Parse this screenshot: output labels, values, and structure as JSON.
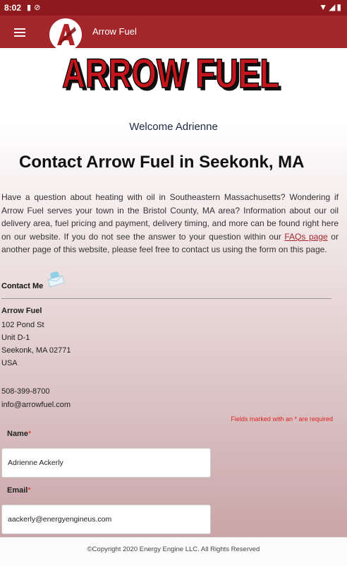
{
  "status_bar": {
    "time": "8:02",
    "left_icons": [
      "sim-card-icon",
      "sync-icon"
    ],
    "right_icons": [
      "wifi-icon",
      "signal-icon",
      "battery-icon"
    ]
  },
  "app_bar": {
    "title": "Arrow Fuel",
    "logo_letter": "A",
    "color": "#a3262a"
  },
  "banner": {
    "text": "ARROW FUEL"
  },
  "welcome": "Welcome Adrienne",
  "page_title": "Contact Arrow Fuel in Seekonk, MA",
  "intro": {
    "text_before_link": " Have a question about heating with oil in Southeastern Massachusetts? Wondering if Arrow Fuel serves your town in the Bristol County, MA area? Information about our oil delivery area, fuel pricing and payment, delivery timing, and more can be found right here on our website. If you do not see the answer to your question within our ",
    "link_text": "FAQs page",
    "text_after_link": " or another page of this website, please feel free to contact us using the form on this page."
  },
  "contact": {
    "heading": "Contact Me",
    "name": "Arrow Fuel",
    "street": "102 Pond St",
    "unit": "Unit D-1",
    "city": "Seekonk, MA 02771",
    "country": "USA",
    "phone": "508-399-8700",
    "email": "info@arrowfuel.com"
  },
  "form": {
    "required_note": "Fields marked with an * are required",
    "name_label": "Name",
    "name_value": "Adrienne Ackerly",
    "email_label": "Email",
    "email_value": "aackerly@energyengineus.com",
    "required_marker": "*"
  },
  "footer": "©Copyright 2020 Energy Engine LLC. All Rights Reserved"
}
